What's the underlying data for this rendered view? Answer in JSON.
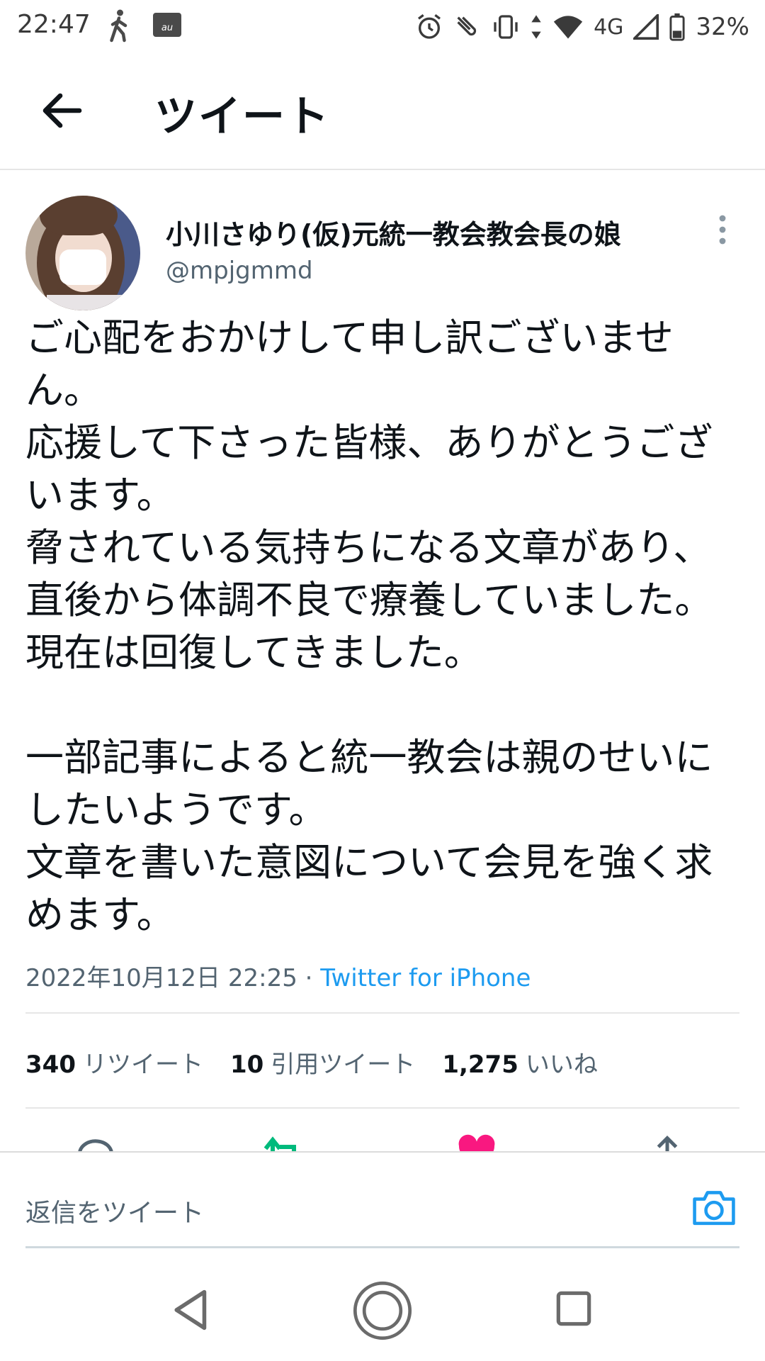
{
  "status_bar": {
    "time": "22:47",
    "network": "4G",
    "battery": "32%",
    "icons": [
      "walk-icon",
      "mail-icon",
      "alarm-icon",
      "nfc-icon",
      "vibrate-icon",
      "data-arrows-icon",
      "wifi-icon",
      "signal-icon",
      "battery-icon"
    ]
  },
  "header": {
    "title": "ツイート"
  },
  "tweet": {
    "author_name": "小川さゆり(仮)元統一教会教会長の娘",
    "handle": "@mpjgmmd",
    "text": "ご心配をおかけして申し訳ございません。\n応援して下さった皆様、ありがとうございます。\n脅されている気持ちになる文章があり、直後から体調不良で療養していました。\n現在は回復してきました。\n\n一部記事によると統一教会は親のせいにしたいようです。\n文章を書いた意図について会見を強く求めます。",
    "timestamp": "2022年10月12日 22:25",
    "separator": " · ",
    "source": "Twitter for iPhone"
  },
  "stats": {
    "retweets_count": "340",
    "retweets_label": "リツイート",
    "quotes_count": "10",
    "quotes_label": "引用ツイート",
    "likes_count": "1,275",
    "likes_label": "いいね"
  },
  "reply": {
    "placeholder": "返信をツイート"
  },
  "colors": {
    "accent": "#1d9bf0",
    "retweet": "#00ba7c",
    "like": "#f91880",
    "text": "#0f1419",
    "secondary": "#536471"
  }
}
